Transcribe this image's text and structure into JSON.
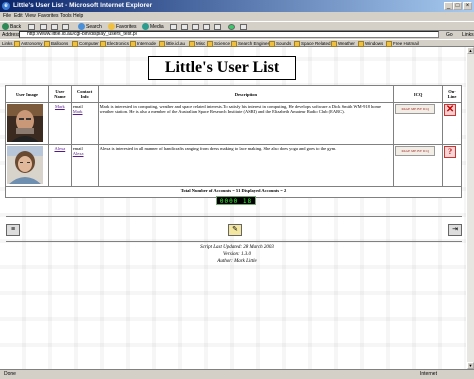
{
  "window": {
    "title": "Little's User List - Microsoft Internet Explorer",
    "buttons": {
      "minimize": "_",
      "maximize": "□",
      "close": "×"
    }
  },
  "menubar": [
    "File",
    "Edit",
    "View",
    "Favorites",
    "Tools",
    "Help"
  ],
  "toolbar": {
    "back": "Back",
    "search": "Search",
    "favorites": "Favorites",
    "media": "Media"
  },
  "address": {
    "label": "Address",
    "url": "http://www.little.id.au/cgi-bin/display_users_test.pl",
    "go": "Go",
    "links": "Links"
  },
  "links": [
    "Astronomy",
    "Balloons",
    "Computer",
    "Electronics",
    "Internode",
    "little.id.au",
    "Misc",
    "Science",
    "Search Engines",
    "Sounds",
    "Space Related",
    "Weather",
    "Windows",
    "Free Hotmail"
  ],
  "page": {
    "title": "Little's User List",
    "table": {
      "headers": [
        "User Image",
        "User Name",
        "Contact Info",
        "Description",
        "ICQ",
        "On-Line"
      ],
      "rows": [
        {
          "name": "Mark",
          "contact_label": "email",
          "contact_link": "Mark",
          "description": "Mark is interested in computing, weather and space related interests.To satisfy his interest in computing, He develops software a Dick Smith WM-918 home weather station. He is also a member of the Australian Space Research Institute (ASRI) and the Elizabeth Amateur Radio Club (EARC).",
          "icq_badge": "PAGE ME BY ICQ",
          "online_icon": "offline-icon",
          "online_glyph": "✕"
        },
        {
          "name": "Alexa",
          "contact_label": "email",
          "contact_link": "Alexa",
          "description": "Alexa is interested in all manner of handicrafts ranging from dress making to lace making. She also does yoga and goes to the gym.",
          "icq_badge": "PAGE ME BY ICQ",
          "online_icon": "unknown-status-icon",
          "online_glyph": "?"
        }
      ],
      "summary": "Total Number of Accounts = 51  Displayed Accounts = 2"
    },
    "counter": "0000 18",
    "footer": {
      "updated": "Script Last Updated: 28 March 2003",
      "version": "Version: 1.3.0",
      "author": "Author: Mark Little"
    }
  },
  "status": {
    "left": "Done",
    "right": "Internet"
  },
  "colors": {
    "titlebar_start": "#0a246a",
    "titlebar_end": "#a6caf0",
    "link": "#551a8b",
    "counter_text": "#33ff33"
  }
}
